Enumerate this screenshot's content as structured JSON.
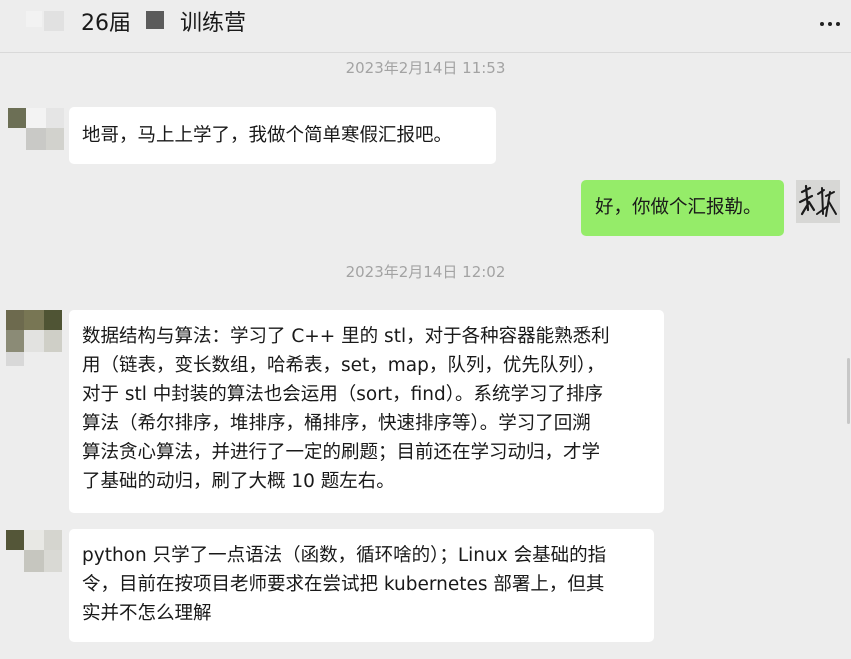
{
  "header": {
    "title_prefix": "26届",
    "title_suffix": "训练营",
    "more_label": "more"
  },
  "messages": [
    {
      "type": "timestamp",
      "text": "2023年2月14日 11:53"
    },
    {
      "type": "message",
      "sender": "other",
      "lines": [
        "地哥，马上上学了，我做个简单寒假汇报吧。"
      ]
    },
    {
      "type": "message",
      "sender": "self",
      "lines": [
        "好，你做个汇报勒。"
      ]
    },
    {
      "type": "timestamp",
      "text": "2023年2月14日 12:02"
    },
    {
      "type": "message",
      "sender": "other",
      "lines": [
        "数据结构与算法：学习了 C++ 里的 stl，对于各种容器能熟悉利",
        "用（链表，变长数组，哈希表，set，map，队列，优先队列），",
        "对于 stl 中封装的算法也会运用（sort，find）。系统学习了排序",
        "算法（希尔排序，堆排序，桶排序，快速排序等）。学习了回溯",
        "算法贪心算法，并进行了一定的刷题；目前还在学习动归，才学",
        "了基础的动归，刷了大概 10 题左右。"
      ]
    },
    {
      "type": "message",
      "sender": "other",
      "lines": [
        "python 只学了一点语法（函数，循环啥的）；Linux 会基础的指",
        "令，目前在按项目老师要求在尝试把 kubernetes 部署上，但其",
        "实并不怎么理解"
      ]
    }
  ],
  "self_avatar_text": "秋",
  "colors": {
    "background": "#ededed",
    "self_bubble": "#95ec69",
    "other_bubble": "#ffffff",
    "timestamp": "#a3a3a3"
  }
}
